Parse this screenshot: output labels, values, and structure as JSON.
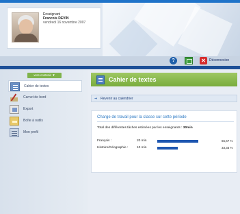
{
  "user": {
    "role": "Enseignant",
    "name": "Francois DEVIN",
    "date": "vendredi 16 novembre 2007"
  },
  "toolbar": {
    "help_label": "?",
    "logout_label": "Déconnexion"
  },
  "sidebar": {
    "tab_label": "vers contenir ▼",
    "items": [
      {
        "label": "Cahier de textes",
        "icon": "notebook-icon",
        "active": true
      },
      {
        "label": "Carnet de bord",
        "icon": "pen-icon",
        "active": false
      },
      {
        "label": "Export",
        "icon": "export-icon",
        "active": false
      },
      {
        "label": "Boîte à outils",
        "icon": "toolbox-icon",
        "active": false
      },
      {
        "label": "Mon profil",
        "icon": "profile-icon",
        "active": false
      }
    ]
  },
  "main": {
    "section_title": "Cahier de textes",
    "back_link": "Revenir au calendrier",
    "panel": {
      "title": "Charge de travail pour la classe sur cette période",
      "total_label": "Total des différentes tâches estimées par les enseignants :",
      "total_value": "30min",
      "rows": [
        {
          "subject": "Français :",
          "time": "20 min",
          "percent": "66,67 %",
          "fraction": 0.6667
        },
        {
          "subject": "Histoire/Géographie :",
          "time": "10 min",
          "percent": "33,33 %",
          "fraction": 0.3333
        }
      ]
    }
  },
  "colors": {
    "accent_blue": "#1d4f97",
    "section_green": "#78ac3c",
    "bar_blue": "#1e56b0",
    "logout_red": "#d62b2b"
  }
}
